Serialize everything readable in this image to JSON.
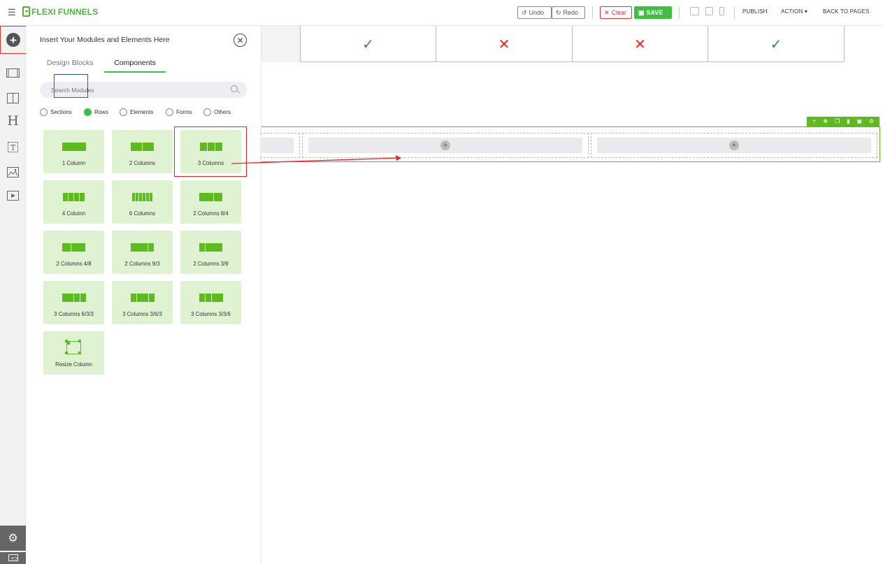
{
  "topbar": {
    "logo_text": "FLEXI FUNNELS",
    "undo_label": "Undo",
    "redo_label": "Redo",
    "clear_label": "Clear",
    "save_label": "SAVE",
    "publish_label": "PUBLISH",
    "action_label": "ACTION",
    "back_label": "BACK TO PAGES"
  },
  "panel": {
    "title": "Insert Your Modules and Elements Here",
    "tabs": [
      "Design Blocks",
      "Components"
    ],
    "active_tab": "Components",
    "search_placeholder": "Search Modules",
    "filters": [
      "Sections",
      "Rows",
      "Elements",
      "Forms",
      "Others"
    ],
    "selected_filter": "Rows",
    "tiles": [
      {
        "label": "1 Column"
      },
      {
        "label": "2 Columns"
      },
      {
        "label": "3 Columns"
      },
      {
        "label": "4 Column"
      },
      {
        "label": "6 Columns"
      },
      {
        "label": "2 Columns 8/4"
      },
      {
        "label": "2 Columns 4/8"
      },
      {
        "label": "2 Columns 9/3"
      },
      {
        "label": "2 Columns 3/9"
      },
      {
        "label": "3 Columns 6/3/3"
      },
      {
        "label": "3 Columns 3/6/3"
      },
      {
        "label": "3 Columns 3/3/6"
      },
      {
        "label": "Resize Column"
      }
    ]
  },
  "canvas": {
    "table_marks": [
      "",
      "✓",
      "✕",
      "✕",
      "✓"
    ]
  },
  "colors": {
    "accent": "#3fbf3f",
    "tile_bg": "#dff2d2",
    "tile_icon": "#5dbb1f",
    "highlight_red": "#dd2222",
    "highlight_blue": "#2255dd"
  }
}
